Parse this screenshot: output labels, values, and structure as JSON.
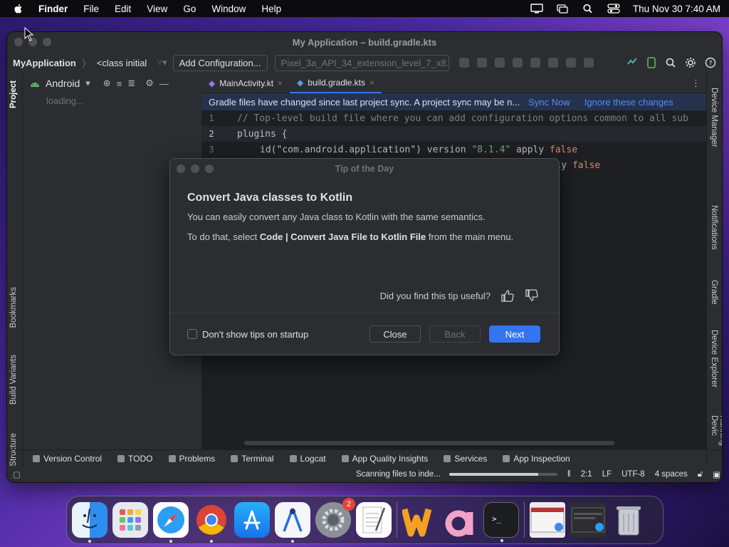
{
  "menubar": {
    "app": "Finder",
    "items": [
      "File",
      "Edit",
      "View",
      "Go",
      "Window",
      "Help"
    ],
    "clock": "Thu Nov 30  7:40 AM"
  },
  "ide": {
    "title": "My Application – build.gradle.kts",
    "toolbar": {
      "project": "MyApplication",
      "class_selector": "<class initial",
      "add_config": "Add Configuration...",
      "device": "Pixel_3a_API_34_extension_level_7_x8..."
    },
    "project_panel": {
      "view": "Android",
      "loading": "loading..."
    },
    "left_tabs": [
      "Project",
      "Bookmarks",
      "Build Variants",
      "Structure"
    ],
    "right_tabs": [
      "Device Manager",
      "Notifications",
      "Gradle",
      "Device Explorer",
      "Running Devic"
    ],
    "tabs": [
      {
        "label": "MainActivity.kt"
      },
      {
        "label": "build.gradle.kts"
      }
    ],
    "banner": {
      "message": "Gradle files have changed since last project sync. A project sync may be n...",
      "sync": "Sync Now",
      "ignore": "Ignore these changes"
    },
    "code": {
      "line1": "// Top-level build file where you can add configuration options common to all sub",
      "line2": "plugins {",
      "line3_id": "id(\"com.android.application\")",
      "line3_version": " version ",
      "line3_str": "\"8.1.4\"",
      "line3_apply": " apply ",
      "line3_false": "false",
      "line4_apply": "apply ",
      "line4_false": "false"
    },
    "bottom_tools": [
      "Version Control",
      "TODO",
      "Problems",
      "Terminal",
      "Logcat",
      "App Quality Insights",
      "Services",
      "App Inspection"
    ],
    "status": {
      "task": "Scanning files to inde...",
      "progress": 0.82,
      "position": "2:1",
      "line_sep": "LF",
      "encoding": "UTF-8",
      "indent": "4 spaces"
    }
  },
  "dialog": {
    "title": "Tip of the Day",
    "heading": "Convert Java classes to Kotlin",
    "text1": "You can easily convert any Java class to Kotlin with the same semantics.",
    "text2_pre": "To do that, select ",
    "text2_bold": "Code | Convert Java File to Kotlin File",
    "text2_post": " from the main menu.",
    "useful": "Did you find this tip useful?",
    "dont_show": "Don't show tips on startup",
    "close": "Close",
    "back": "Back",
    "next": "Next"
  },
  "dock": {
    "settings_badge": "2"
  }
}
